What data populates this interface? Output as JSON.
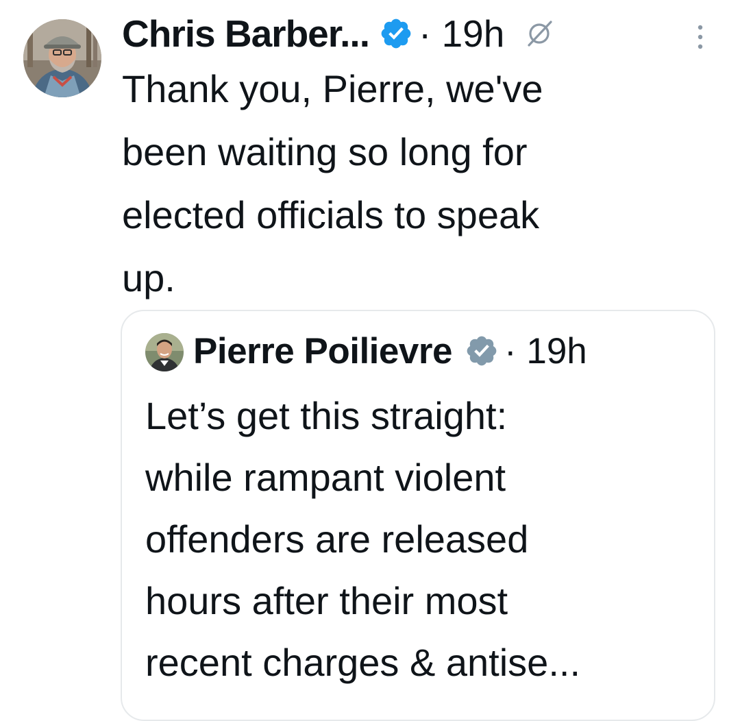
{
  "tweet": {
    "author_name": "Chris Barber...",
    "time": "· 19h",
    "text": "Thank you, Pierre,  we've\nbeen waiting so long for\nelected officials to speak\nup."
  },
  "quoted_tweet": {
    "author_name": "Pierre Poilievre",
    "time": "· 19h",
    "text": "Let’s get this straight:\nwhile rampant violent\noffenders are released\nhours after their most\nrecent charges & antise..."
  },
  "icons": {
    "verified_primary": "verified-badge-icon",
    "verified_secondary": "verified-badge-grey-icon",
    "grok": "grok-icon",
    "more": "more-vertical-icon"
  },
  "colors": {
    "text": "#0f1419",
    "verified_blue": "#1d9bf0",
    "verified_grey": "#829aab",
    "border": "#e6e9eb",
    "icon_grey": "#8b98a5"
  }
}
